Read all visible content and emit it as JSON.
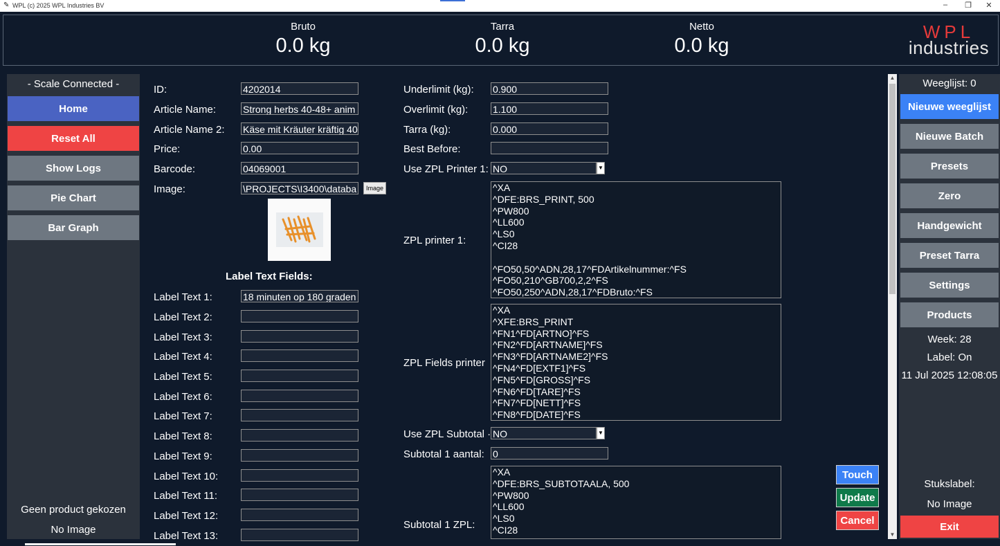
{
  "window": {
    "title": "WPL (c) 2025 WPL Industries BV",
    "controls": [
      "–",
      "❐",
      "✕"
    ]
  },
  "header": {
    "bruto_label": "Bruto",
    "bruto_value": "0.0 kg",
    "tarra_label": "Tarra",
    "tarra_value": "0.0 kg",
    "netto_label": "Netto",
    "netto_value": "0.0 kg",
    "logo_top": "WPL",
    "logo_bottom": "industries"
  },
  "left": {
    "status": "- Scale Connected -",
    "buttons": [
      "Home",
      "Reset All",
      "Show Logs",
      "Pie Chart",
      "Bar Graph"
    ],
    "product_status": "Geen product gekozen",
    "image_status": "No Image"
  },
  "form": {
    "id_label": "ID:",
    "id_value": "4202014",
    "article_name_label": "Article Name:",
    "article_name_value": "Strong herbs 40-48+ anim",
    "article_name2_label": "Article Name 2:",
    "article_name2_value": "Käse mit Kräuter kräftig 40",
    "price_label": "Price:",
    "price_value": "0.00",
    "barcode_label": "Barcode:",
    "barcode_value": "04069001",
    "image_label": "Image:",
    "image_value": "\\PROJECTS\\I3400\\databa",
    "image_button": "Image",
    "label_text_heading": "Label Text Fields:",
    "label_texts": [
      {
        "label": "Label Text 1:",
        "value": "18 minuten op 180 graden"
      },
      {
        "label": "Label Text 2:",
        "value": ""
      },
      {
        "label": "Label Text 3:",
        "value": ""
      },
      {
        "label": "Label Text 4:",
        "value": ""
      },
      {
        "label": "Label Text 5:",
        "value": ""
      },
      {
        "label": "Label Text 6:",
        "value": ""
      },
      {
        "label": "Label Text 7:",
        "value": ""
      },
      {
        "label": "Label Text 8:",
        "value": ""
      },
      {
        "label": "Label Text 9:",
        "value": ""
      },
      {
        "label": "Label Text 10:",
        "value": ""
      },
      {
        "label": "Label Text 11:",
        "value": ""
      },
      {
        "label": "Label Text 12:",
        "value": ""
      },
      {
        "label": "Label Text 13:",
        "value": ""
      }
    ],
    "underlimit_label": "Underlimit (kg):",
    "underlimit_value": "0.900",
    "overlimit_label": "Overlimit (kg):",
    "overlimit_value": "1.100",
    "tarra_label": "Tarra (kg):",
    "tarra_value": "0.000",
    "best_before_label": "Best Before:",
    "best_before_value": "",
    "use_zpl_label": "Use ZPL Printer 1:",
    "use_zpl_value": "NO",
    "zpl_printer_label": "ZPL printer 1:",
    "zpl_printer_value": "^XA\n^DFE:BRS_PRINT, 500\n^PW800\n^LL600\n^LS0\n^CI28\n\n^FO50,50^ADN,28,17^FDArtikelnummer:^FS\n^FO50,210^GB700,2,2^FS\n^FO50,250^ADN,28,17^FDBruto:^FS",
    "zpl_fields_label": "ZPL Fields printer",
    "zpl_fields_value": "^XA\n^XFE:BRS_PRINT\n^FN1^FD[ARTNO]^FS\n^FN2^FD[ARTNAME]^FS\n^FN3^FD[ARTNAME2]^FS\n^FN4^FD[EXTF1]^FS\n^FN5^FD[GROSS]^FS\n^FN6^FD[TARE]^FS\n^FN7^FD[NETT]^FS\n^FN8^FD[DATE]^FS",
    "use_zpl_subtotal_label": "Use ZPL Subtotal ·",
    "use_zpl_subtotal_value": "NO",
    "subtotal_aantal_label": "Subtotal 1 aantal:",
    "subtotal_aantal_value": "0",
    "subtotal_zpl_label": "Subtotal 1 ZPL:",
    "subtotal_zpl_value": "^XA\n^DFE:BRS_SUBTOTAALA, 500\n^PW800\n^LL600\n^LS0\n^CI28"
  },
  "actions": {
    "touch": "Touch",
    "update": "Update",
    "cancel": "Cancel"
  },
  "right": {
    "weeglijst": "Weeglijst: 0",
    "buttons": [
      "Nieuwe weeglijst",
      "Nieuwe Batch",
      "Presets",
      "Zero",
      "Handgewicht",
      "Preset Tarra",
      "Settings",
      "Products"
    ],
    "week": "Week: 28",
    "label_status": "Label: On",
    "datetime": "11 Jul 2025 12:08:05",
    "stukslabel": "Stukslabel:",
    "image_status": "No Image",
    "exit": "Exit"
  },
  "colors": {
    "background": "#0f1a2b",
    "panel": "#2b323c",
    "button_grey": "#6e7781",
    "button_blue": "#4a63c2",
    "button_bright_blue": "#3b82f6",
    "button_red": "#ef4444",
    "button_green": "#0f7a4a",
    "logo_red": "#e53a3a"
  }
}
